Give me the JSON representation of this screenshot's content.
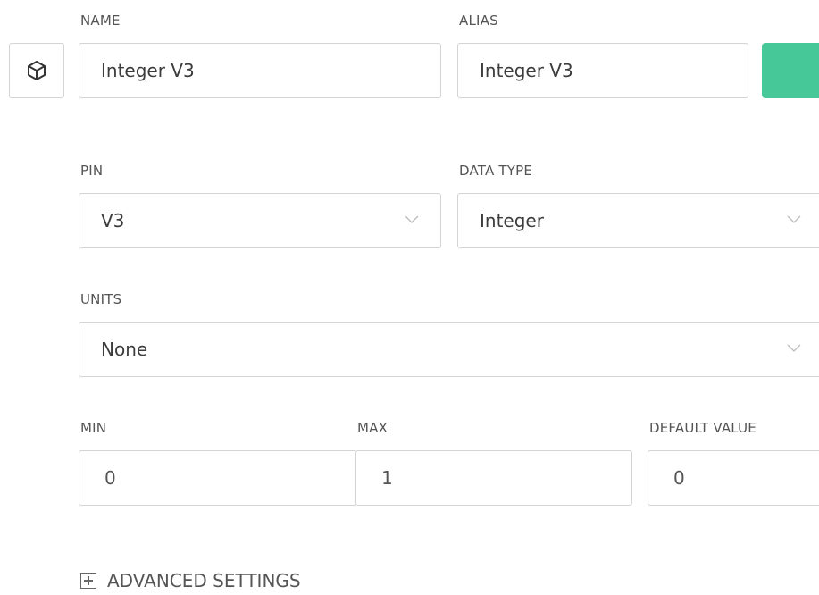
{
  "labels": {
    "name": "NAME",
    "alias": "ALIAS",
    "pin": "PIN",
    "data_type": "DATA TYPE",
    "units": "UNITS",
    "min": "MIN",
    "max": "MAX",
    "default_value": "DEFAULT VALUE"
  },
  "fields": {
    "name_value": "Integer V3",
    "alias_value": "Integer V3",
    "pin_value": "V3",
    "data_type_value": "Integer",
    "units_value": "None",
    "min_value": "0",
    "max_value": "1",
    "default_value": "0"
  },
  "icons": {
    "datastream": "cube-icon",
    "dropdown": "chevron-down-icon",
    "advanced": "plus-square-icon"
  },
  "colors": {
    "swatch": "#46c899"
  },
  "advanced": {
    "label": "ADVANCED SETTINGS"
  }
}
